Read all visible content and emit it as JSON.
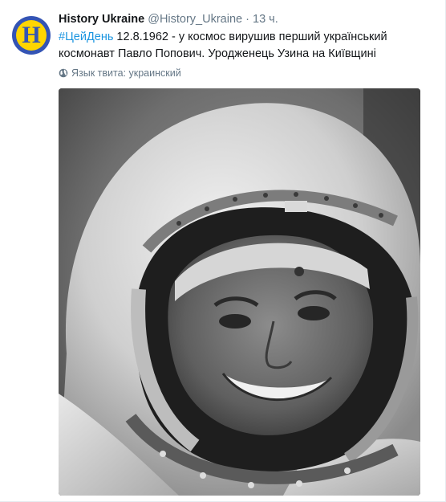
{
  "tweet": {
    "avatar_letter": "H",
    "fullname": "History Ukraine",
    "username": "@History_Ukraine",
    "separator": "·",
    "time": "13 ч.",
    "hashtag": "#ЦейДень",
    "body": " 12.8.1962 - у космос вирушив перший український космонавт Павло Попович. Уродженець Узина на Київщині",
    "language_label": "Язык твита: украинский",
    "photo_description": "astronaut-portrait"
  },
  "colors": {
    "link": "#1b95e0",
    "secondary_text": "#657786",
    "avatar_bg": "#3454b4",
    "avatar_ring": "#ffd500"
  },
  "icons": {
    "language": "globe-icon"
  }
}
